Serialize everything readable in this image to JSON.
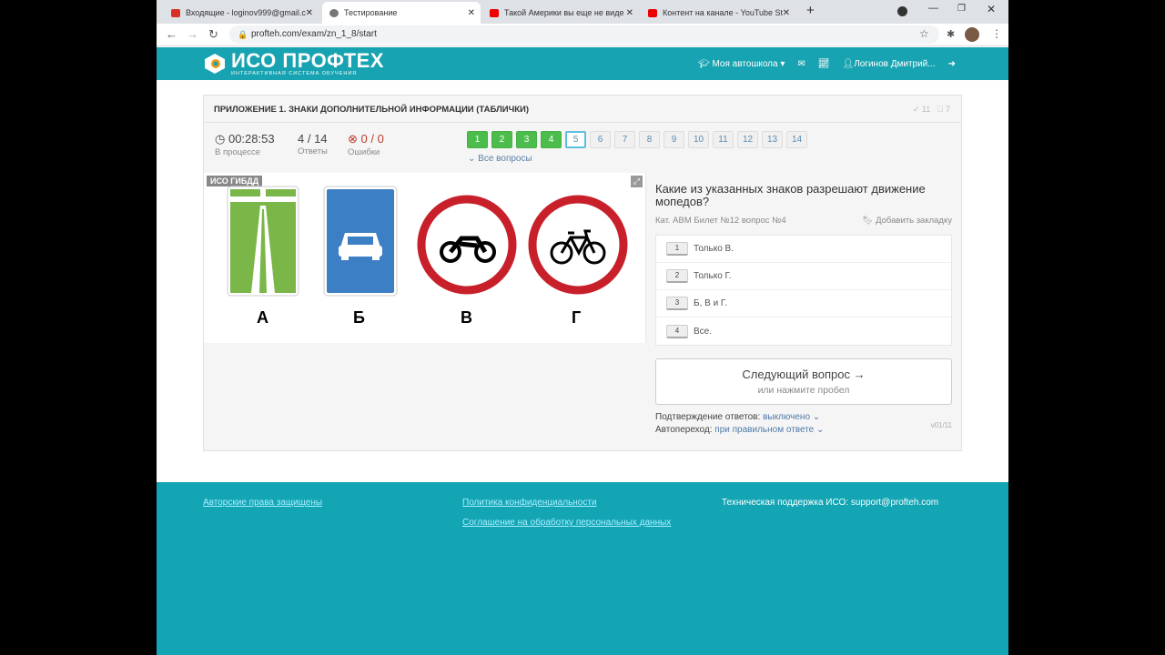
{
  "browser": {
    "tabs": [
      {
        "title": "Входящие - loginov999@gmail.c",
        "active": false
      },
      {
        "title": "Тестирование",
        "active": true
      },
      {
        "title": "Такой Америки вы еще не виде",
        "active": false
      },
      {
        "title": "Контент на канале - YouTube St",
        "active": false
      }
    ],
    "url": "profteh.com/exam/zn_1_8/start"
  },
  "header": {
    "logo_title": "ИСО ПРОФТЕХ",
    "logo_subtitle": "ИНТЕРАКТИВНАЯ СИСТЕМА ОБУЧЕНИЯ",
    "school_menu": "Моя автошкола",
    "user_name": "Логинов Дмитрий..."
  },
  "exam": {
    "title": "ПРИЛОЖЕНИЕ 1. ЗНАКИ ДОПОЛНИТЕЛЬНОЙ ИНФОРМАЦИИ (ТАБЛИЧКИ)",
    "correct_count": "11",
    "blocked_count": "7",
    "timer": "00:28:53",
    "timer_label": "В процессе",
    "answered": "4 / 14",
    "answered_label": "Ответы",
    "errors": "0 / 0",
    "errors_label": "Ошибки",
    "questions": [
      {
        "n": "1",
        "state": "done"
      },
      {
        "n": "2",
        "state": "done"
      },
      {
        "n": "3",
        "state": "done"
      },
      {
        "n": "4",
        "state": "done"
      },
      {
        "n": "5",
        "state": "current"
      },
      {
        "n": "6",
        "state": "todo"
      },
      {
        "n": "7",
        "state": "todo"
      },
      {
        "n": "8",
        "state": "todo"
      },
      {
        "n": "9",
        "state": "todo"
      },
      {
        "n": "10",
        "state": "todo"
      },
      {
        "n": "11",
        "state": "todo"
      },
      {
        "n": "12",
        "state": "todo"
      },
      {
        "n": "13",
        "state": "todo"
      },
      {
        "n": "14",
        "state": "todo"
      }
    ],
    "all_questions": "Все вопросы",
    "image_badge": "ИСО  ГИБДД",
    "sign_labels": [
      "А",
      "Б",
      "В",
      "Г"
    ],
    "question": "Какие из указанных знаков разрешают движение мопедов?",
    "meta": "Кат. ABM  Билет №12  вопрос №4",
    "bookmark": "Добавить закладку",
    "answers": [
      {
        "key": "1",
        "text": "Только В."
      },
      {
        "key": "2",
        "text": "Только Г."
      },
      {
        "key": "3",
        "text": "Б, В и Г."
      },
      {
        "key": "4",
        "text": "Все."
      }
    ],
    "next_label": "Следующий вопрос →",
    "next_hint": "или нажмите пробел",
    "confirm_label": "Подтверждение ответов:",
    "confirm_value": "выключено",
    "auto_label": "Автопереход:",
    "auto_value": "при правильном ответе",
    "version": "v01/11"
  },
  "footer": {
    "copyright": "Авторские права защищены",
    "privacy": "Политика конфиденциальности",
    "consent": "Соглашение на обработку персональных данных",
    "support": "Техническая поддержка ИСО:  support@profteh.com"
  },
  "colors": {
    "teal": "#17a3b1",
    "green": "#4cbd4c",
    "red": "#c8202a",
    "blue": "#3d7fc4"
  }
}
